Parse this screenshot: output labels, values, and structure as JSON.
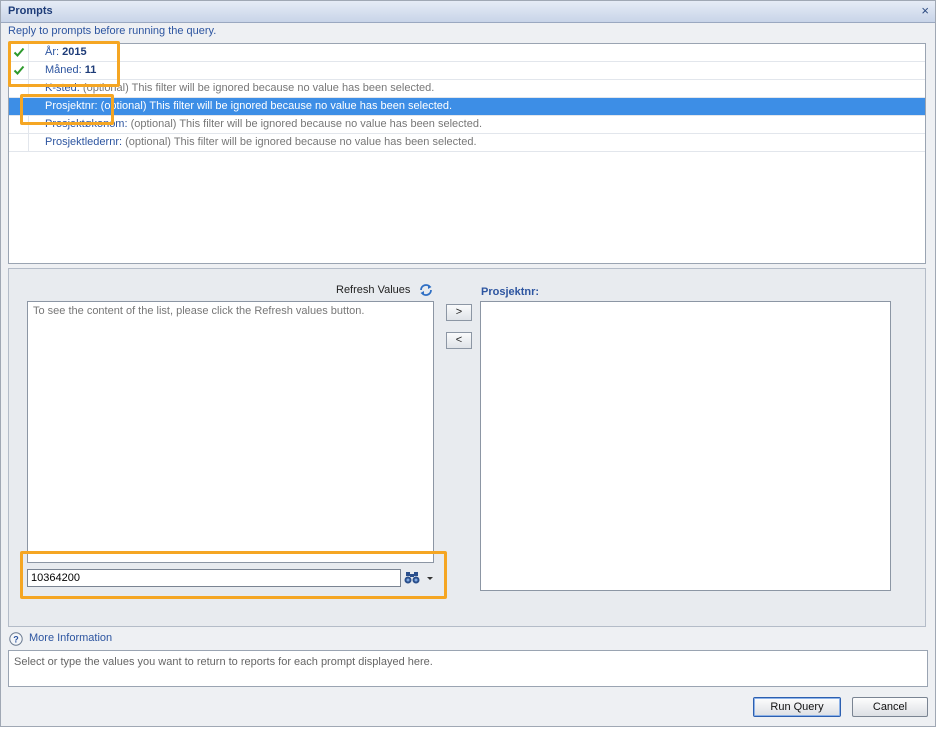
{
  "dialog": {
    "title": "Prompts",
    "close_symbol": "×",
    "instruction": "Reply to prompts before running the query."
  },
  "prompts": [
    {
      "name": "År",
      "separator": ":",
      "value": "2015",
      "note": "",
      "answered": true,
      "selected": false
    },
    {
      "name": "Måned",
      "separator": ":",
      "value": "11",
      "note": "",
      "answered": true,
      "selected": false
    },
    {
      "name": "K-sted",
      "separator": ":",
      "value": "",
      "note": " (optional) This filter will be ignored because no value has been selected.",
      "answered": false,
      "selected": false
    },
    {
      "name": "Prosjektnr",
      "separator": ":",
      "value": "",
      "note": " (optional) This filter will be ignored because no value has been selected.",
      "answered": false,
      "selected": true
    },
    {
      "name": "Prosjektøkonom",
      "separator": ":",
      "value": "",
      "note": " (optional) This filter will be ignored because no value has been selected.",
      "answered": false,
      "selected": false
    },
    {
      "name": "Prosjektledernr",
      "separator": ":",
      "value": "",
      "note": " (optional) This filter will be ignored because no value has been selected.",
      "answered": false,
      "selected": false
    }
  ],
  "values_panel": {
    "refresh_label": "Refresh Values",
    "refresh_icon": "refresh-icon",
    "list_hint": "To see the content of the list, please click the Refresh values button.",
    "add_button": ">",
    "remove_button": "<",
    "selected_title": "Prosjektnr:",
    "search_value": "10364200",
    "search_icon": "binoculars-icon"
  },
  "more_info": {
    "label": "More Information",
    "icon": "help-icon",
    "text": "Select or type the values you want to return to reports for each prompt displayed here."
  },
  "buttons": {
    "run_query": "Run Query",
    "cancel": "Cancel"
  },
  "colors": {
    "selection": "#3d8ee6",
    "highlight": "#f5a623",
    "link": "#2d55a0"
  }
}
